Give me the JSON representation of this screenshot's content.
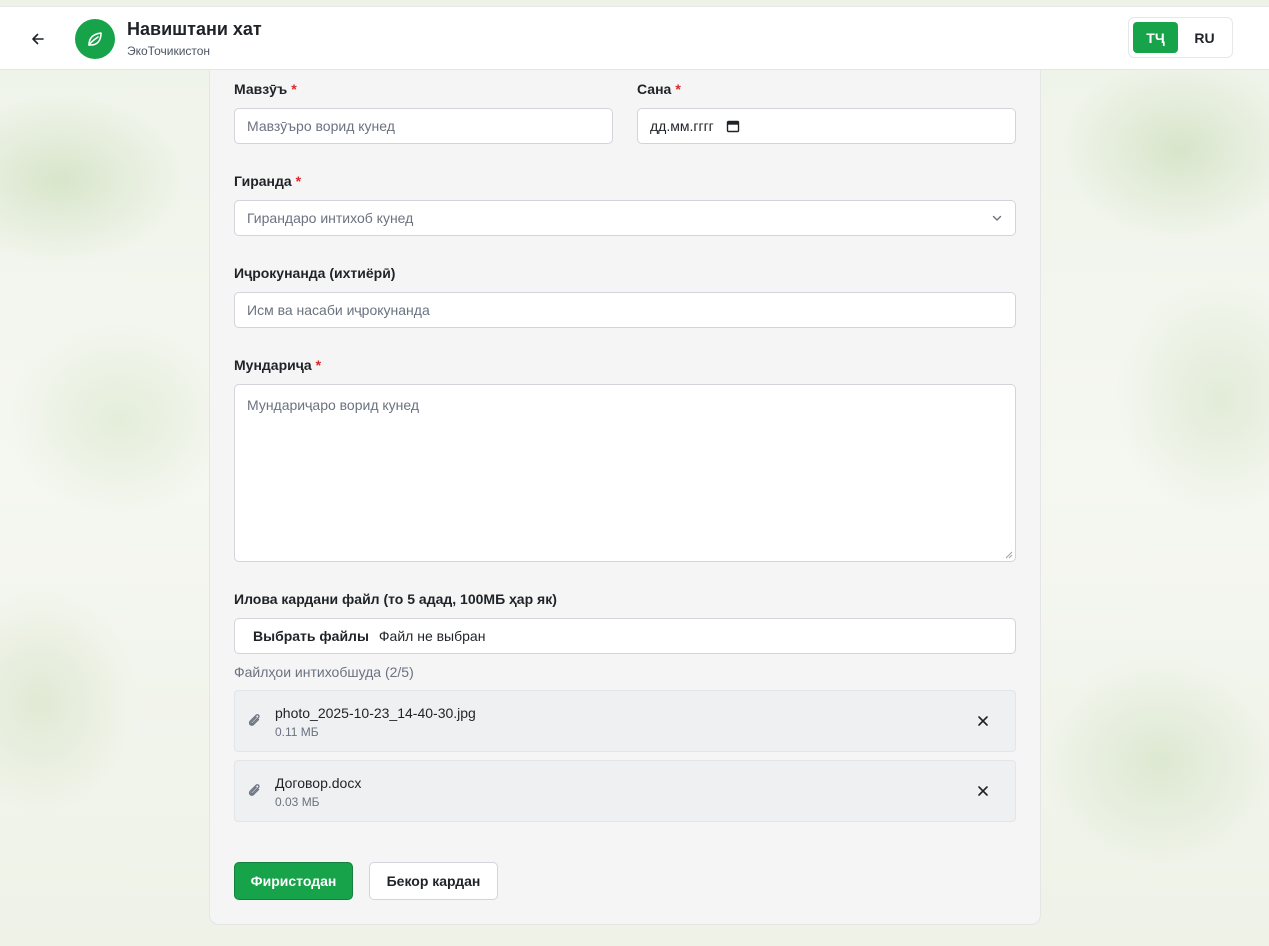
{
  "header": {
    "title": "Навиштани хат",
    "subtitle": "ЭкоТочикистон",
    "languages": [
      {
        "label": "ТҶ",
        "active": true
      },
      {
        "label": "RU",
        "active": false
      }
    ]
  },
  "form": {
    "subject": {
      "label": "Мавзӯъ",
      "required_mark": "*",
      "placeholder": "Мавзӯъро ворид кунед",
      "value": ""
    },
    "date": {
      "label": "Сана",
      "required_mark": "*",
      "placeholder": "дд.мм.гггг"
    },
    "recipient": {
      "label": "Гиранда",
      "required_mark": "*",
      "selected": "Гирандаро интихоб кунед"
    },
    "executor": {
      "label": "Иҷрокунанда (ихтиёрӣ)",
      "placeholder": "Исм ва насаби иҷрокунанда",
      "value": ""
    },
    "content": {
      "label": "Мундариҷа",
      "required_mark": "*",
      "placeholder": "Мундариҷаро ворид кунед"
    },
    "attachments": {
      "label": "Илова кардани файл (то 5 адад, 100МБ ҳар як)",
      "choose_button": "Выбрать файлы",
      "no_file_text": "Файл не выбран",
      "selected_caption": "Файлҳои интихобшуда (2/5)",
      "files": [
        {
          "name": "photo_2025-10-23_14-40-30.jpg",
          "size": "0.11 МБ"
        },
        {
          "name": "Договор.docx",
          "size": "0.03 МБ"
        }
      ]
    },
    "submit_label": "Фиристодан",
    "cancel_label": "Бекор кардан"
  },
  "colors": {
    "accent": "#16a34a",
    "required": "#dc2626"
  },
  "icons": {
    "back": "arrow-left-icon",
    "logo": "leaf-icon",
    "attachment": "paperclip-icon",
    "remove": "close-icon",
    "dropdown": "chevron-down-icon",
    "calendar": "calendar-icon"
  }
}
